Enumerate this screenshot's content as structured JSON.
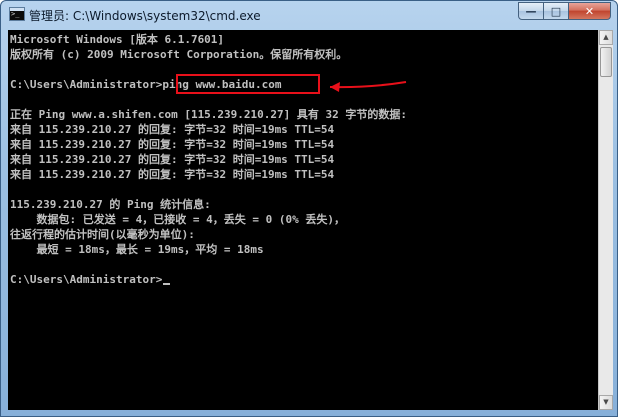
{
  "window": {
    "title": "管理员: C:\\Windows\\system32\\cmd.exe",
    "icon": "cmd-console-icon",
    "buttons": {
      "minimize": "—",
      "maximize": "□",
      "close": "✕"
    }
  },
  "console": {
    "lines": {
      "l0": "Microsoft Windows [版本 6.1.7601]",
      "l1": "版权所有 (c) 2009 Microsoft Corporation。保留所有权利。",
      "l2": "",
      "l3": "",
      "l4": "",
      "l5": "正在 Ping www.a.shifen.com [115.239.210.27] 具有 32 字节的数据:",
      "l6": "来自 115.239.210.27 的回复: 字节=32 时间=19ms TTL=54",
      "l7": "来自 115.239.210.27 的回复: 字节=32 时间=19ms TTL=54",
      "l8": "来自 115.239.210.27 的回复: 字节=32 时间=19ms TTL=54",
      "l9": "来自 115.239.210.27 的回复: 字节=32 时间=19ms TTL=54",
      "l10": "",
      "l11": "115.239.210.27 的 Ping 统计信息:",
      "l12": "    数据包: 已发送 = 4，已接收 = 4，丢失 = 0 (0% 丢失)，",
      "l13": "往返行程的估计时间(以毫秒为单位):",
      "l14": "    最短 = 18ms，最长 = 19ms，平均 = 18ms",
      "l15": "",
      "l16": ""
    },
    "prompt1": "C:\\Users\\Administrator>",
    "command": "ping www.baidu.com",
    "prompt2": "C:\\Users\\Administrator>"
  },
  "colors": {
    "console_bg": "#000000",
    "console_text": "#c0c0c0",
    "highlight": "#e8101a"
  }
}
